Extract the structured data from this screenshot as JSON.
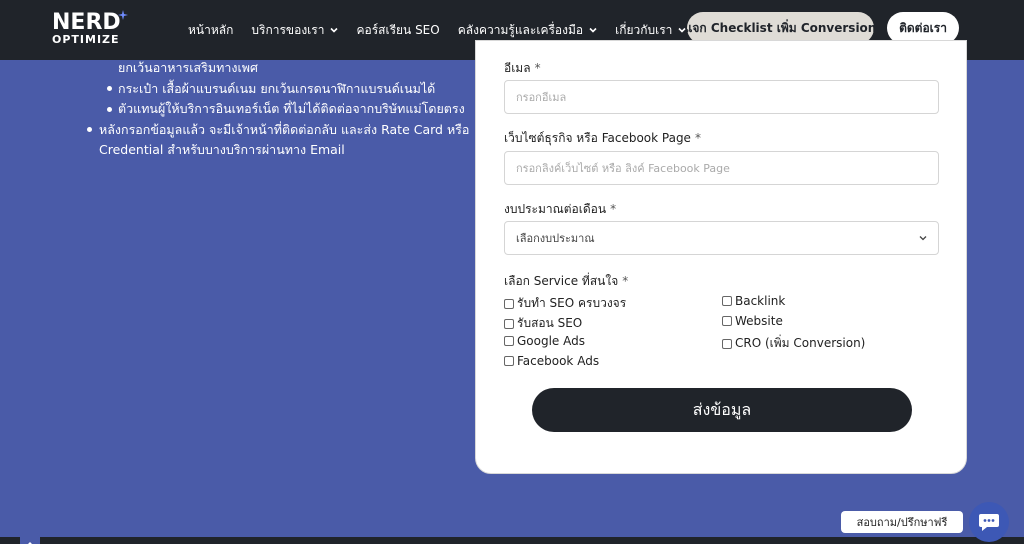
{
  "header": {
    "logo_top": "NERD",
    "logo_bottom": "OPTIMIZE",
    "nav": [
      {
        "label": "หน้าหลัก",
        "has_dropdown": false
      },
      {
        "label": "บริการของเรา",
        "has_dropdown": true
      },
      {
        "label": "คอร์สเรียน SEO",
        "has_dropdown": false
      },
      {
        "label": "คลังความรู้และเครื่องมือ",
        "has_dropdown": true
      },
      {
        "label": "เกี่ยวกับเรา",
        "has_dropdown": true
      }
    ],
    "cta_checklist": "แจก Checklist เพิ่ม Conversion",
    "cta_contact": "ติดต่อเรา"
  },
  "left_list": {
    "lines": [
      "ยกเว้นอาหารเสริมทางเพศ",
      "กระเป๋า เสื้อผ้าแบรนด์เนม ยกเว้นเกรดนาฬิกาแบรนด์เนมได้",
      "ตัวแทนผู้ให้บริการอินเทอร์เน็ต ที่ไม่ได้ติดต่อจากบริษัทแม่โดยตรง",
      "หลังกรอกข้อมูลแล้ว จะมีเจ้าหน้าที่ติดต่อกลับ และส่ง Rate Card หรือ",
      "Credential สำหรับบางบริการผ่านทาง Email"
    ]
  },
  "form": {
    "email_label": "อีเมล",
    "email_placeholder": "กรอกอีเมล",
    "website_label": "เว็บไซต์ธุรกิจ หรือ Facebook Page",
    "website_placeholder": "กรอกลิงค์เว็บไซต์ หรือ ลิงค์ Facebook Page",
    "budget_label": "งบประมาณต่อเดือน",
    "budget_value": "เลือกงบประมาณ",
    "services_label": "เลือก Service ที่สนใจ",
    "required_mark": "*",
    "services_left": [
      "รับทำ SEO ครบวงจร",
      "รับสอน SEO",
      "Google Ads",
      "Facebook Ads"
    ],
    "services_right": [
      "Backlink",
      "Website",
      "CRO (เพิ่ม Conversion)"
    ],
    "submit_label": "ส่งข้อมูล"
  },
  "chat": {
    "label": "สอบถาม/ปรึกษาฟรี"
  },
  "colors": {
    "background": "#4a5ba8",
    "header": "#20242a",
    "accent": "#3d58b5"
  }
}
